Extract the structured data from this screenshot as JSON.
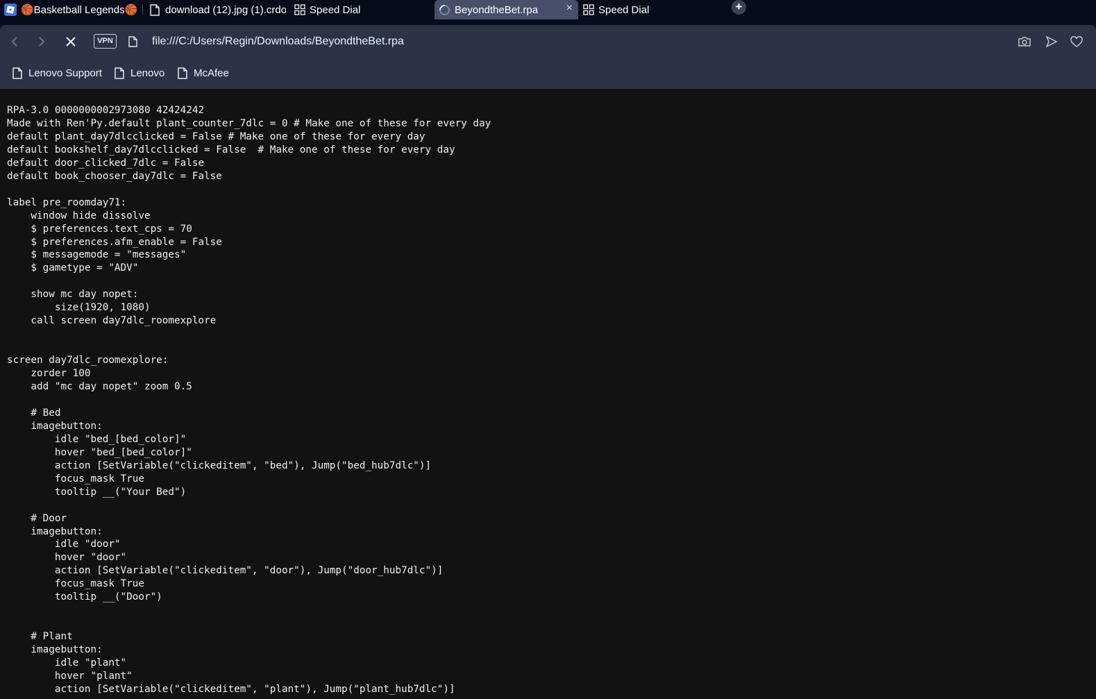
{
  "tabs": [
    {
      "label": "🏀Basketball Legends🏀",
      "icon": "roblox-icon",
      "active": false
    },
    {
      "label": "download (12).jpg (1).crdo",
      "icon": "document-icon",
      "active": false
    },
    {
      "label": "Speed Dial",
      "icon": "speed-dial-icon",
      "active": false
    },
    {
      "label": "BeyondtheBet.rpa",
      "icon": "loading-spinner-icon",
      "active": true,
      "close": "×"
    },
    {
      "label": "Speed Dial",
      "icon": "speed-dial-icon",
      "active": false
    }
  ],
  "new_tab_label": "+",
  "navbar": {
    "vpn_label": "VPN",
    "url": "file:///C:/Users/Regin/Downloads/BeyondtheBet.rpa"
  },
  "bookmarks": [
    {
      "label": "Lenovo Support"
    },
    {
      "label": "Lenovo"
    },
    {
      "label": "McAfee"
    }
  ],
  "document_text": "RPA-3.0 0000000002973080 42424242\nMade with Ren'Py.default plant_counter_7dlc = 0 # Make one of these for every day\ndefault plant_day7dlcclicked = False # Make one of these for every day\ndefault bookshelf_day7dlcclicked = False  # Make one of these for every day\ndefault door_clicked_7dlc = False\ndefault book_chooser_day7dlc = False\n\nlabel pre_roomday71:\n    window hide dissolve\n    $ preferences.text_cps = 70\n    $ preferences.afm_enable = False\n    $ messagemode = \"messages\"\n    $ gametype = \"ADV\"\n\n    show mc day nopet:\n        size(1920, 1080)\n    call screen day7dlc_roomexplore\n\n\nscreen day7dlc_roomexplore:\n    zorder 100\n    add \"mc day nopet\" zoom 0.5\n\n    # Bed\n    imagebutton:\n        idle \"bed_[bed_color]\"\n        hover \"bed_[bed_color]\"\n        action [SetVariable(\"clickeditem\", \"bed\"), Jump(\"bed_hub7dlc\")]\n        focus_mask True\n        tooltip __(\"Your Bed\")\n\n    # Door\n    imagebutton:\n        idle \"door\"\n        hover \"door\"\n        action [SetVariable(\"clickeditem\", \"door\"), Jump(\"door_hub7dlc\")]\n        focus_mask True\n        tooltip __(\"Door\")\n\n\n    # Plant\n    imagebutton:\n        idle \"plant\"\n        hover \"plant\"\n        action [SetVariable(\"clickeditem\", \"plant\"), Jump(\"plant_hub7dlc\")]"
}
